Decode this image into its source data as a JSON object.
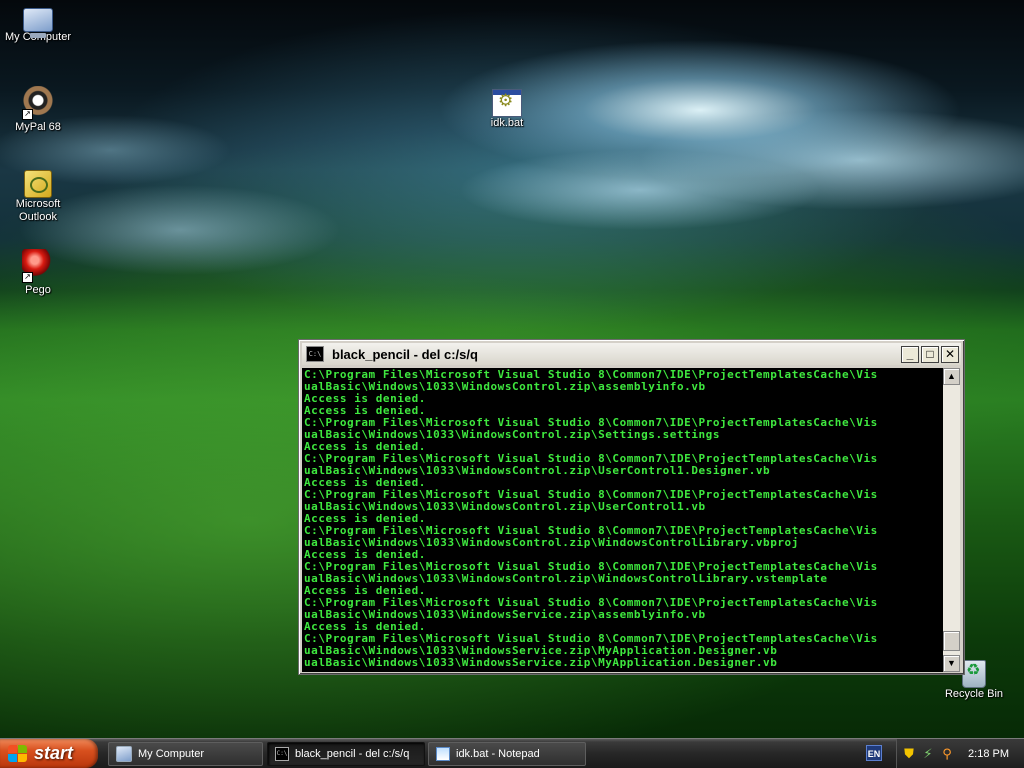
{
  "desktop": {
    "icons": [
      {
        "label": "My Computer",
        "icon": "my-computer-icon"
      },
      {
        "label": "MyPal 68",
        "icon": "mypal-browser-icon"
      },
      {
        "label": "Microsoft Outlook",
        "icon": "outlook-icon"
      },
      {
        "label": "Pego",
        "icon": "pego-red-ball-icon"
      },
      {
        "label": "idk.bat",
        "icon": "batch-file-icon"
      },
      {
        "label": "Recycle Bin",
        "icon": "recycle-bin-icon"
      }
    ]
  },
  "console": {
    "title": "black_pencil - del c:/s/q",
    "app_icon_text": "C:\\",
    "minimize": "_",
    "maximize": "□",
    "close": "✕",
    "text_color": "#3fe83f",
    "lines": [
      "C:\\Program Files\\Microsoft Visual Studio 8\\Common7\\IDE\\ProjectTemplatesCache\\Vis",
      "ualBasic\\Windows\\1033\\WindowsControl.zip\\assemblyinfo.vb",
      "Access is denied.",
      "Access is denied.",
      "C:\\Program Files\\Microsoft Visual Studio 8\\Common7\\IDE\\ProjectTemplatesCache\\Vis",
      "ualBasic\\Windows\\1033\\WindowsControl.zip\\Settings.settings",
      "Access is denied.",
      "C:\\Program Files\\Microsoft Visual Studio 8\\Common7\\IDE\\ProjectTemplatesCache\\Vis",
      "ualBasic\\Windows\\1033\\WindowsControl.zip\\UserControl1.Designer.vb",
      "Access is denied.",
      "C:\\Program Files\\Microsoft Visual Studio 8\\Common7\\IDE\\ProjectTemplatesCache\\Vis",
      "ualBasic\\Windows\\1033\\WindowsControl.zip\\UserControl1.vb",
      "Access is denied.",
      "C:\\Program Files\\Microsoft Visual Studio 8\\Common7\\IDE\\ProjectTemplatesCache\\Vis",
      "ualBasic\\Windows\\1033\\WindowsControl.zip\\WindowsControlLibrary.vbproj",
      "Access is denied.",
      "C:\\Program Files\\Microsoft Visual Studio 8\\Common7\\IDE\\ProjectTemplatesCache\\Vis",
      "ualBasic\\Windows\\1033\\WindowsControl.zip\\WindowsControlLibrary.vstemplate",
      "Access is denied.",
      "C:\\Program Files\\Microsoft Visual Studio 8\\Common7\\IDE\\ProjectTemplatesCache\\Vis",
      "ualBasic\\Windows\\1033\\WindowsService.zip\\assemblyinfo.vb",
      "Access is denied.",
      "C:\\Program Files\\Microsoft Visual Studio 8\\Common7\\IDE\\ProjectTemplatesCache\\Vis",
      "ualBasic\\Windows\\1033\\WindowsService.zip\\MyApplication.Designer.vb",
      "ualBasic\\Windows\\1033\\WindowsService.zip\\MyApplication.Designer.vb"
    ]
  },
  "taskbar": {
    "start_label": "start",
    "buttons": [
      {
        "label": "My Computer",
        "icon": "my-computer-icon",
        "active": false
      },
      {
        "label": "black_pencil - del c:/s/q",
        "icon": "command-prompt-icon",
        "active": true
      },
      {
        "label": "idk.bat - Notepad",
        "icon": "notepad-icon",
        "active": false
      }
    ],
    "language": "EN",
    "clock": "2:18 PM"
  }
}
